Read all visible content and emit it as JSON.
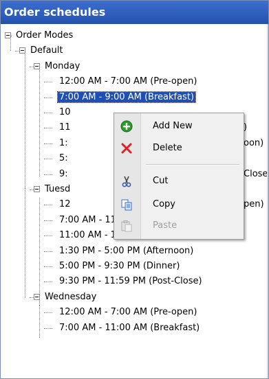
{
  "header": {
    "title": "Order schedules"
  },
  "tree": [
    {
      "label": "Order Modes",
      "level": 0,
      "expanded": true
    },
    {
      "label": "Default",
      "level": 1,
      "expanded": true
    },
    {
      "label": "Monday",
      "level": 2,
      "expanded": true
    },
    {
      "label": "12:00 AM - 7:00 AM (Pre-open)",
      "level": 3
    },
    {
      "label": "7:00 AM - 9:00 AM (Breakfast)",
      "level": 3,
      "selected": true
    },
    {
      "label": "10",
      "level": 3
    },
    {
      "label": "11",
      "level": 3,
      "tail": ")"
    },
    {
      "label": "1:",
      "level": 3,
      "tail": "oon)"
    },
    {
      "label": "5:",
      "level": 3,
      "tail": ""
    },
    {
      "label": "9:",
      "level": 3,
      "tail": "Close"
    },
    {
      "label": "Tuesd",
      "level": 2,
      "expanded": true
    },
    {
      "label": "12",
      "level": 3,
      "tail": "pen)"
    },
    {
      "label": "7:00 AM - 11:00 AM (Breakfast)",
      "level": 3
    },
    {
      "label": "11:00 AM - 1:30 PM (Lunch)",
      "level": 3
    },
    {
      "label": "1:30 PM - 5:00 PM (Afternoon)",
      "level": 3
    },
    {
      "label": "5:00 PM - 9:30 PM (Dinner)",
      "level": 3
    },
    {
      "label": "9:30 PM - 11:59 PM (Post-Close)",
      "level": 3
    },
    {
      "label": "Wednesday",
      "level": 2,
      "expanded": true
    },
    {
      "label": "12:00 AM - 7:00 AM (Pre-open)",
      "level": 3
    },
    {
      "label": "7:00 AM - 11:00 AM (Breakfast)",
      "level": 3
    }
  ],
  "context_menu": {
    "items": [
      {
        "label": "Add New",
        "icon": "add-icon",
        "enabled": true
      },
      {
        "label": "Delete",
        "icon": "delete-icon",
        "enabled": true
      },
      {
        "separator": true
      },
      {
        "label": "Cut",
        "icon": "cut-icon",
        "enabled": true
      },
      {
        "label": "Copy",
        "icon": "copy-icon",
        "enabled": true
      },
      {
        "label": "Paste",
        "icon": "paste-icon",
        "enabled": false
      }
    ]
  },
  "colors": {
    "header_bg": "#2b5bbd",
    "selection": "#1f4fb4",
    "add_green": "#2e9b2e",
    "delete_red": "#e02020"
  }
}
